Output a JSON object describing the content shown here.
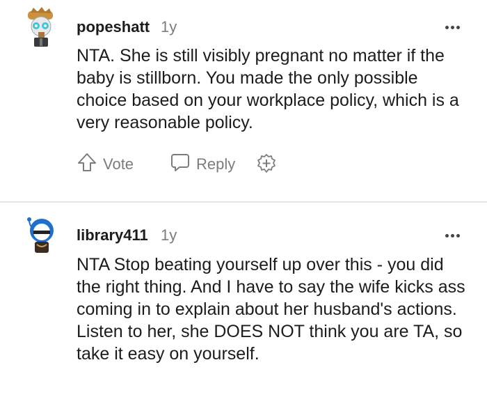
{
  "comments": [
    {
      "username": "popeshatt",
      "age": "1y",
      "body": "NTA. She is still visibly pregnant no matter if the baby is stillborn. You made the only possible choice based on your workplace policy, which is a very reasonable policy.",
      "vote_label": "Vote",
      "reply_label": "Reply"
    },
    {
      "username": "library411",
      "age": "1y",
      "body": "NTA Stop beating yourself up over this - you did the right thing. And I have to say the wife kicks ass coming in to explain about her husband's actions. Listen to her, she DOES NOT think you are TA, so take it easy on yourself."
    }
  ],
  "colors": {
    "text": "#1c1c1c",
    "muted": "#7c7c7c",
    "divider": "#e6e6e6"
  },
  "icons": [
    "upvote-arrow-icon",
    "reply-bubble-icon",
    "award-plus-icon",
    "more-options-icon"
  ]
}
